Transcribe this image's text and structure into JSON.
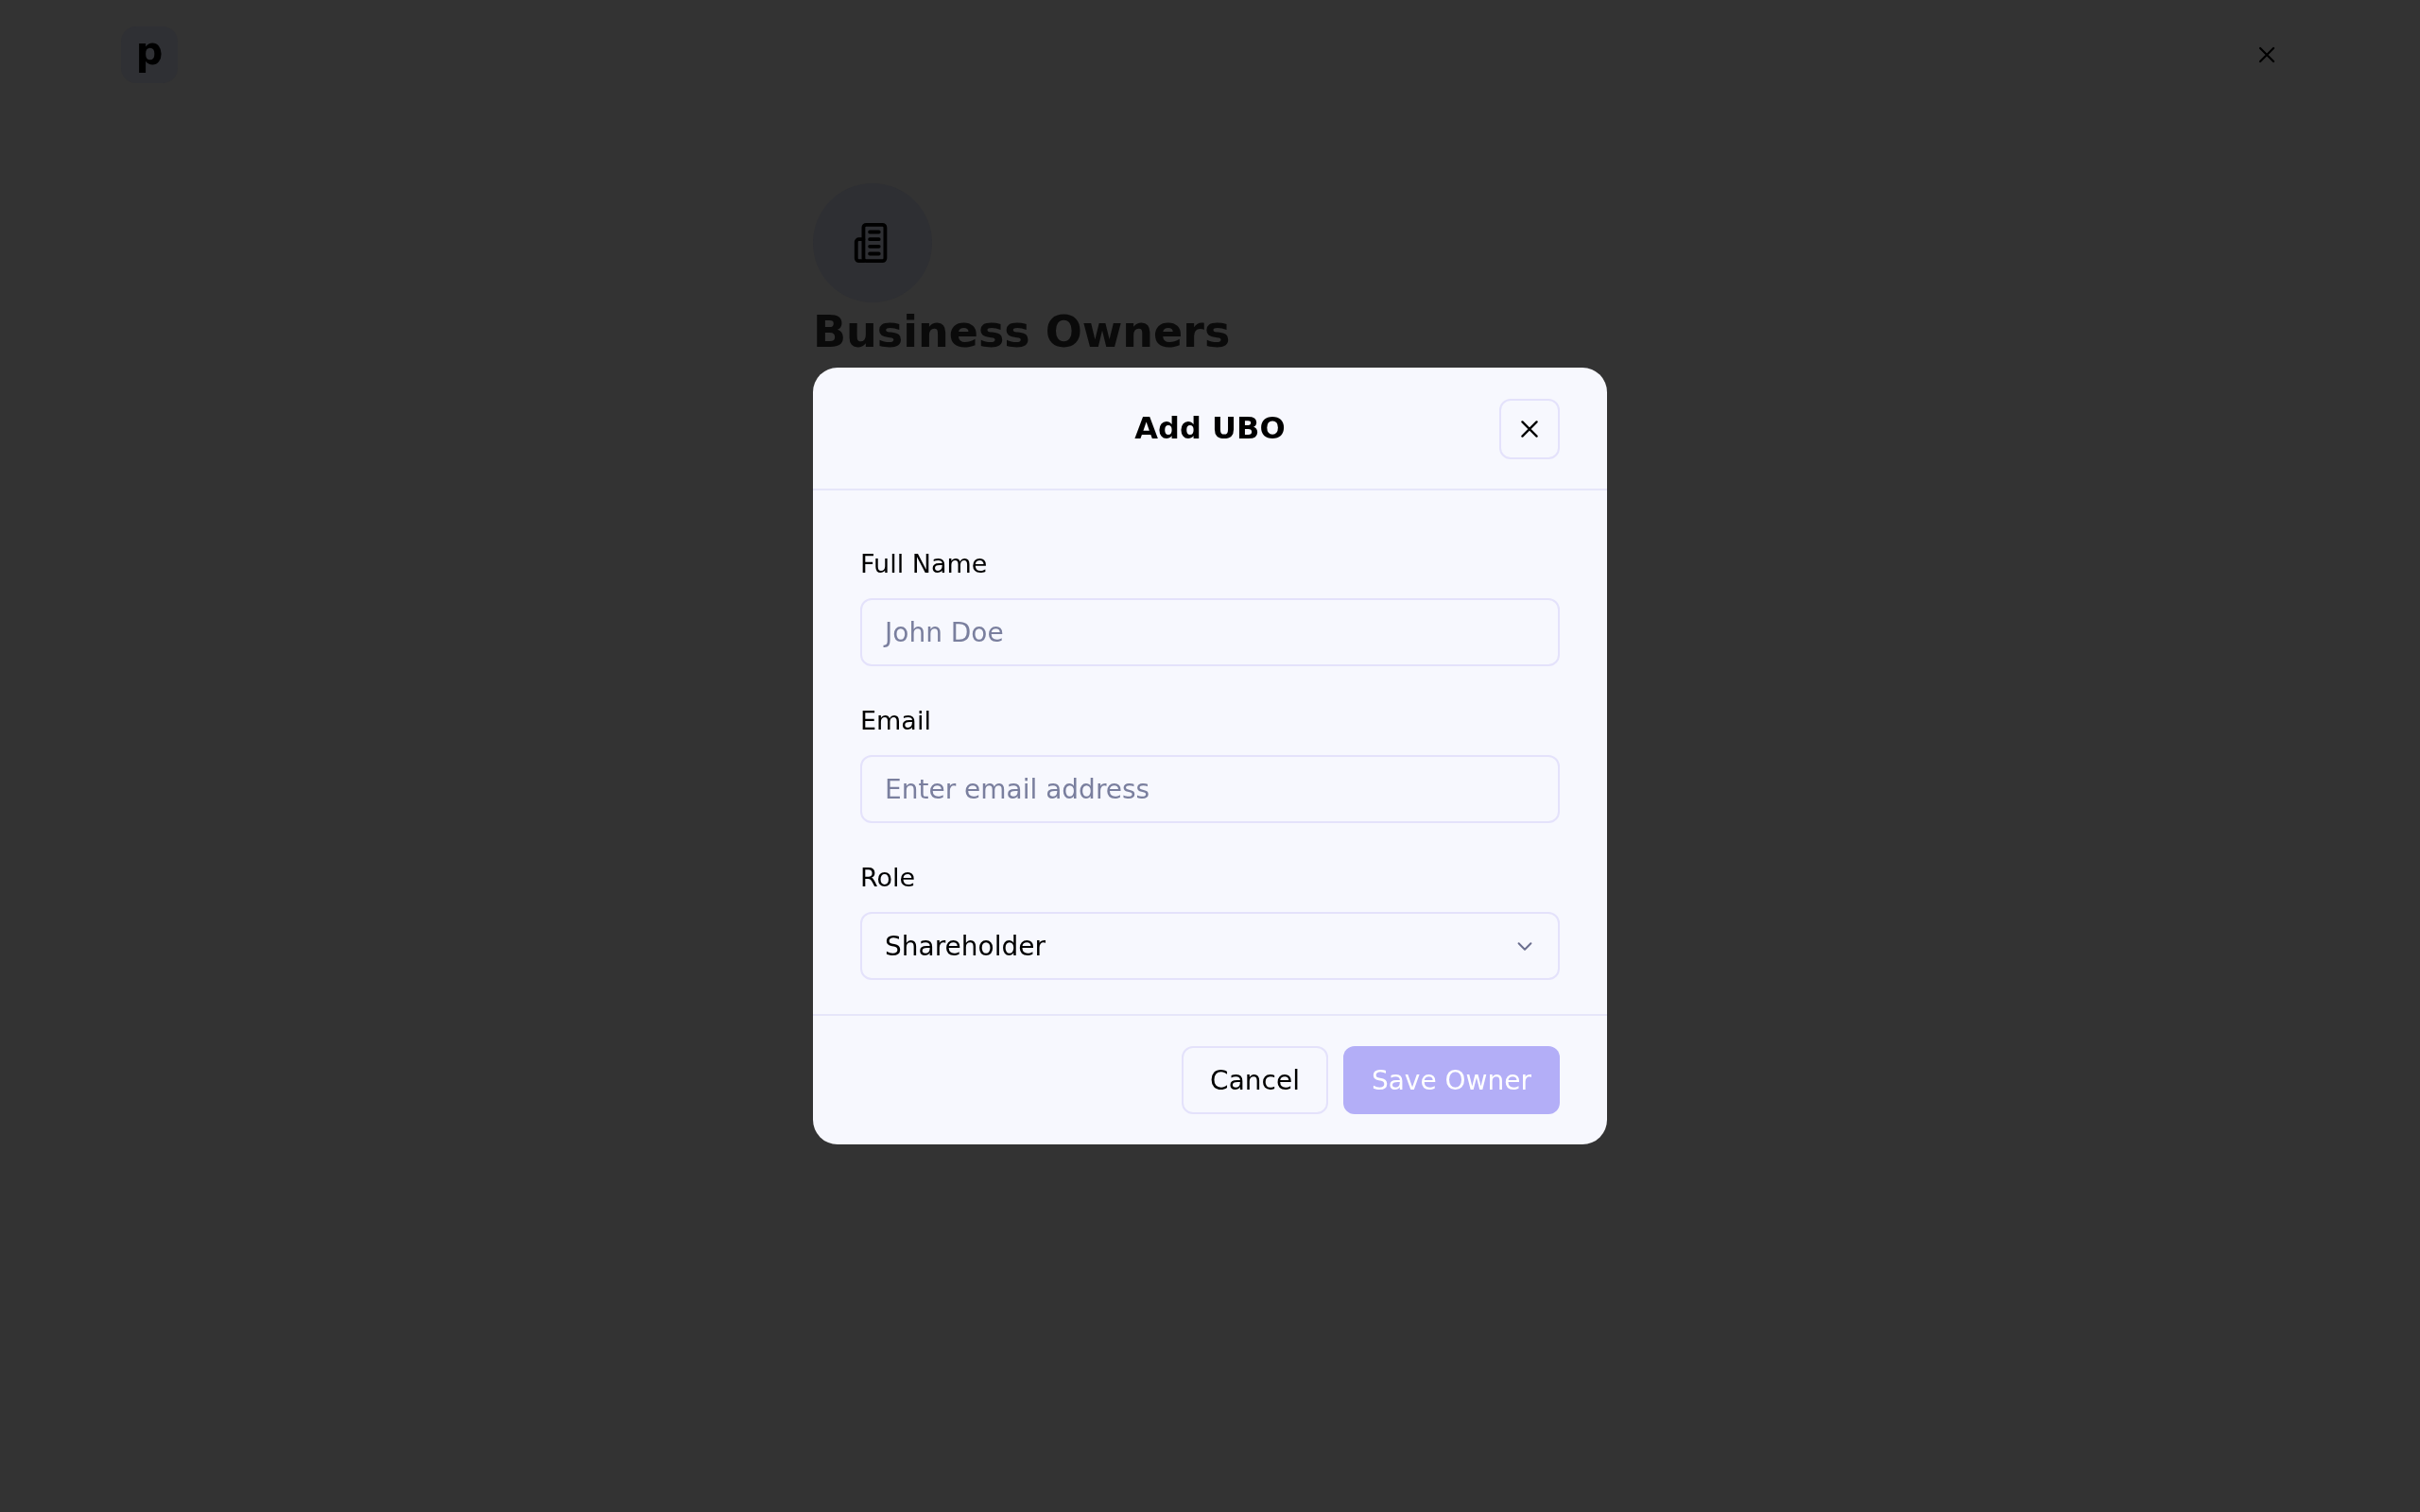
{
  "brand": {
    "logo_letter": "p"
  },
  "page": {
    "title": "Business Owners"
  },
  "dialog": {
    "title": "Add UBO",
    "fields": [
      {
        "kind": "text",
        "label": "Full Name",
        "placeholder": "John Doe"
      },
      {
        "kind": "text",
        "label": "Email",
        "placeholder": "Enter email address"
      },
      {
        "kind": "select",
        "label": "Role",
        "value": "Shareholder"
      }
    ],
    "buttons": [
      {
        "kind": "secondary",
        "label": "Cancel",
        "disabled": false
      },
      {
        "kind": "primary",
        "label": "Save Owner",
        "disabled": true
      }
    ]
  }
}
